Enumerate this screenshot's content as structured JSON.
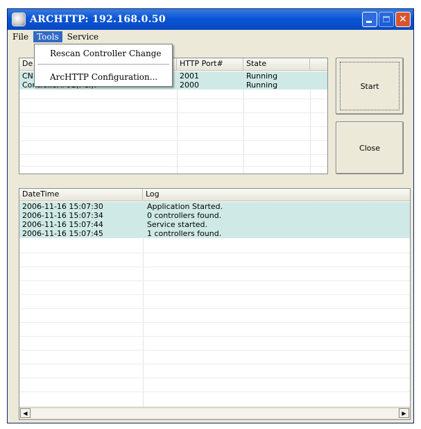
{
  "window": {
    "title": "ARCHTTP: 192.168.0.50",
    "app_icon": "archttp-app-icon",
    "buttons": [
      "minimize-icon",
      "maximize-icon",
      "close-icon"
    ]
  },
  "menubar": {
    "items": [
      "File",
      "Tools",
      "Service"
    ],
    "active": "Tools"
  },
  "tools_menu": {
    "items": [
      "Rescan Controller Change",
      "ArcHTTP Configuration..."
    ]
  },
  "controllers": {
    "columns": [
      "De",
      "HTTP Port#",
      "State"
    ],
    "rows": [
      {
        "name": "CN",
        "port": "2001",
        "state": "Running",
        "selected": true
      },
      {
        "name": "Controller#01(PCI):",
        "port": "2000",
        "state": "Running",
        "selected": true
      }
    ]
  },
  "buttons": {
    "start": "Start",
    "close": "Close"
  },
  "log": {
    "columns": [
      "DateTime",
      "Log"
    ],
    "rows": [
      {
        "datetime": "2006-11-16 15:07:30",
        "message": "Application Started."
      },
      {
        "datetime": "2006-11-16 15:07:34",
        "message": "0 controllers found."
      },
      {
        "datetime": "2006-11-16 15:07:44",
        "message": "Service started."
      },
      {
        "datetime": "2006-11-16 15:07:45",
        "message": "1 controllers found."
      }
    ]
  },
  "scrollbar": {
    "left_icon": "scroll-left-arrow-icon",
    "right_icon": "scroll-right-arrow-icon"
  },
  "colors": {
    "titlebar": "#0a55d6",
    "selection_highlight": "#cfeae6",
    "menu_highlight": "#316ac5"
  }
}
